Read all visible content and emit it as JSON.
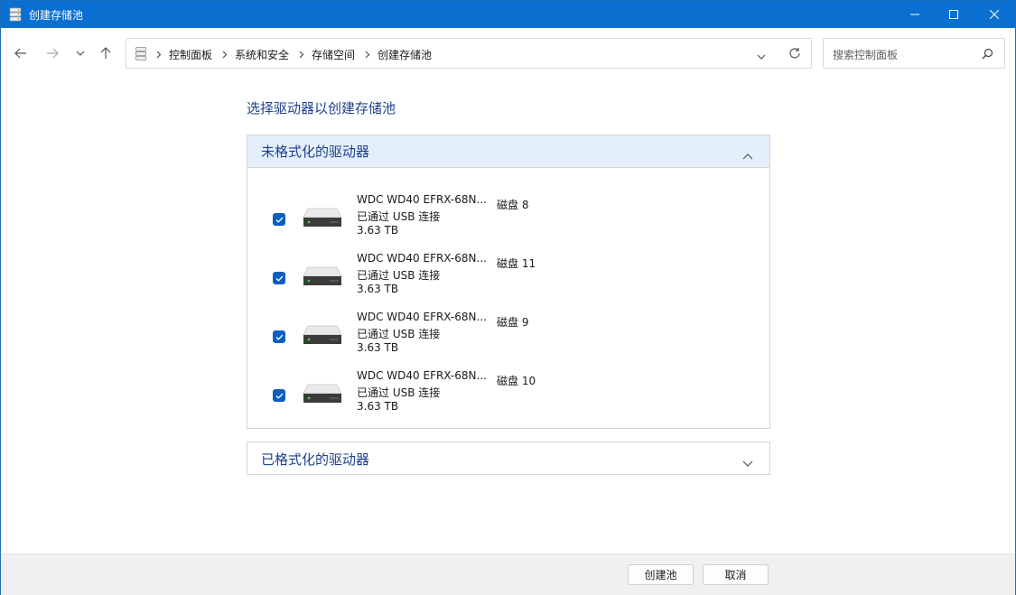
{
  "window": {
    "title": "创建存储池"
  },
  "address": {
    "breadcrumbs": [
      "控制面板",
      "系统和安全",
      "存储空间",
      "创建存储池"
    ]
  },
  "search": {
    "placeholder": "搜索控制面板"
  },
  "main": {
    "heading": "选择驱动器以创建存储池",
    "unformatted_section": {
      "title": "未格式化的驱动器",
      "expanded": true,
      "drives": [
        {
          "name": "WDC WD40 EFRX-68N...",
          "disk": "磁盘 8",
          "connection": "已通过 USB 连接",
          "size": "3.63 TB",
          "checked": true
        },
        {
          "name": "WDC WD40 EFRX-68N...",
          "disk": "磁盘 11",
          "connection": "已通过 USB 连接",
          "size": "3.63 TB",
          "checked": true
        },
        {
          "name": "WDC WD40 EFRX-68N...",
          "disk": "磁盘 9",
          "connection": "已通过 USB 连接",
          "size": "3.63 TB",
          "checked": true
        },
        {
          "name": "WDC WD40 EFRX-68N...",
          "disk": "磁盘 10",
          "connection": "已通过 USB 连接",
          "size": "3.63 TB",
          "checked": true
        }
      ]
    },
    "formatted_section": {
      "title": "已格式化的驱动器",
      "expanded": false
    }
  },
  "footer": {
    "create_label": "创建池",
    "cancel_label": "取消"
  },
  "colors": {
    "titlebar": "#0a6fd0",
    "accent_text": "#1e3f8f",
    "checkbox": "#0a5fc0",
    "section_highlight": "#e3effb"
  }
}
